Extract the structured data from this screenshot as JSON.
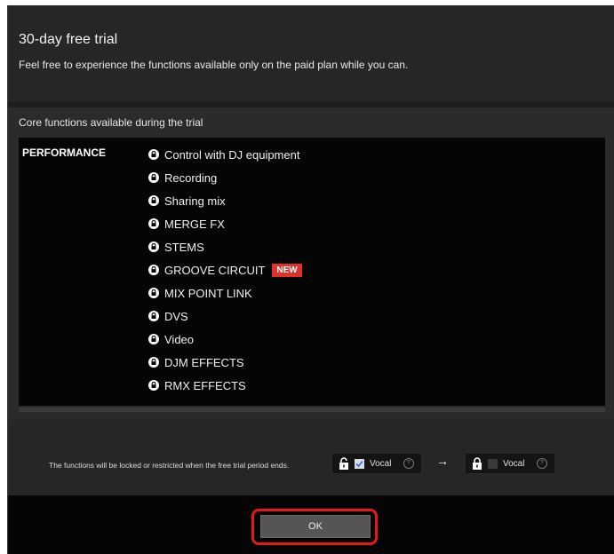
{
  "dialog": {
    "title": "30-day free trial",
    "subtitle": "Feel free to experience the functions available only on the paid plan while you can."
  },
  "core": {
    "heading": "Core functions available during the trial",
    "category": "PERFORMANCE",
    "functions": [
      {
        "label": "Control with DJ equipment",
        "badge": null
      },
      {
        "label": "Recording",
        "badge": null
      },
      {
        "label": "Sharing mix",
        "badge": null
      },
      {
        "label": "MERGE FX",
        "badge": null
      },
      {
        "label": "STEMS",
        "badge": null
      },
      {
        "label": "GROOVE CIRCUIT",
        "badge": "NEW"
      },
      {
        "label": "MIX POINT LINK",
        "badge": null
      },
      {
        "label": "DVS",
        "badge": null
      },
      {
        "label": "Video",
        "badge": null
      },
      {
        "label": "DJM EFFECTS",
        "badge": null
      },
      {
        "label": "RMX EFFECTS",
        "badge": null
      }
    ],
    "item_icon": "lock-icon"
  },
  "footer": {
    "notice": "The functions will be locked or restricted when the free trial period ends.",
    "before": {
      "label": "Vocal",
      "checked": true,
      "icon": "unlocked-padlock-icon",
      "help": "?"
    },
    "arrow": "→",
    "after": {
      "label": "Vocal",
      "checked": false,
      "icon": "locked-padlock-icon",
      "help": "?"
    }
  },
  "actions": {
    "ok_label": "OK"
  },
  "colors": {
    "badge": "#e0302a",
    "highlight": "#e41818",
    "check": "#3b6fd6"
  }
}
